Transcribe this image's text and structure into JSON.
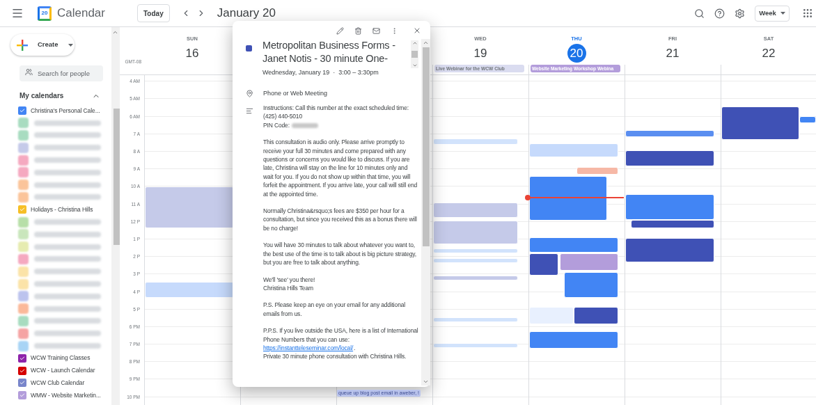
{
  "app": {
    "logo_day": "20",
    "name": "Calendar",
    "today_button": "Today",
    "period_title": "January 20",
    "view_button": "Week"
  },
  "sidebar": {
    "create_button": "Create",
    "search_placeholder": "Search for people",
    "section_title": "My calendars",
    "calendars": [
      {
        "kind": "calendar",
        "label": "Christina's Personal Cale...",
        "color": "#4285f4",
        "checked": true
      },
      {
        "kind": "blurred",
        "color": "#a8dcc0"
      },
      {
        "kind": "blurred",
        "color": "#a8dcc0"
      },
      {
        "kind": "blurred",
        "color": "#c5cae9"
      },
      {
        "kind": "blurred",
        "color": "#f5a9c0"
      },
      {
        "kind": "blurred",
        "color": "#f5a9c0"
      },
      {
        "kind": "blurred",
        "color": "#fbc49a"
      },
      {
        "kind": "blurred",
        "color": "#fbc49a"
      },
      {
        "kind": "calendar",
        "label": "Holidays - Christina Hills",
        "color": "#f6bf26",
        "checked": true
      },
      {
        "kind": "blurred",
        "color": "#b7dfa8"
      },
      {
        "kind": "blurred",
        "color": "#c9e6bc"
      },
      {
        "kind": "blurred",
        "color": "#e6ecb0"
      },
      {
        "kind": "blurred",
        "color": "#f5a9c0"
      },
      {
        "kind": "blurred",
        "color": "#fbe3a8"
      },
      {
        "kind": "blurred",
        "color": "#fbe3a8"
      },
      {
        "kind": "blurred",
        "color": "#bcc3ee"
      },
      {
        "kind": "blurred",
        "color": "#fbb99a"
      },
      {
        "kind": "blurred",
        "color": "#a8dcc0"
      },
      {
        "kind": "blurred",
        "color": "#f5a3a3"
      },
      {
        "kind": "blurred",
        "color": "#a8d4f5"
      },
      {
        "kind": "calendar",
        "label": "WCW Training Classes",
        "color": "#8e24aa",
        "checked": true
      },
      {
        "kind": "calendar",
        "label": "WCW - Launch Calendar",
        "color": "#d50000",
        "checked": true
      },
      {
        "kind": "calendar",
        "label": "WCW Club Calendar",
        "color": "#7986cb",
        "checked": true
      },
      {
        "kind": "calendar",
        "label": "WMW - Website Marketin...",
        "color": "#b39ddb",
        "checked": true
      }
    ]
  },
  "timezone": "GMT-08",
  "hours": [
    "4 AM",
    "5 AM",
    "6 AM",
    "7 A",
    "8 A",
    "9 A",
    "10 A",
    "11 A",
    "12 P",
    "1 P",
    "2 P",
    "3 P",
    "4 P",
    "5 P",
    "6 PM",
    "7 PM",
    "8 PM",
    "9 PM",
    "10 PM"
  ],
  "days": [
    {
      "weekday": "SUN",
      "date": "16",
      "selected": false,
      "events": [
        {
          "color": "#c5cae9"
        },
        {
          "color": "#c6dafc"
        }
      ]
    },
    {
      "weekday": "WED",
      "date": "19",
      "selected": false,
      "all_day": {
        "title": "Live Webinar for the WCW Club",
        "color": "#dadcf0"
      },
      "events": [
        {
          "color": "#d2e3fc"
        },
        {
          "color": "#c5cae9"
        },
        {
          "color": "#c5cae9"
        },
        {
          "color": "#d2e3fc"
        },
        {
          "color": "#d2e3fc"
        },
        {
          "color": "#c5cae9"
        },
        {
          "color": "#d2e3fc"
        },
        {
          "color": "#d2e3fc"
        }
      ]
    },
    {
      "weekday": "THU",
      "date": "20",
      "selected": true,
      "all_day": {
        "title": "Website Marketing Workshop Webina",
        "color": "#b39ddb"
      },
      "events": [
        {
          "color": "#c6dafc"
        },
        {
          "color": "#4285f4"
        },
        {
          "color": "#f6b8a6"
        },
        {
          "color": "#4285f4"
        },
        {
          "color": "#3f51b5"
        },
        {
          "color": "#b39ddb"
        },
        {
          "color": "#4285f4"
        },
        {
          "color": "#e8f0fe"
        },
        {
          "color": "#3f51b5"
        },
        {
          "color": "#4285f4"
        }
      ]
    },
    {
      "weekday": "FRI",
      "date": "21",
      "selected": false,
      "events": [
        {
          "color": "#5a8ef0"
        },
        {
          "color": "#3f51b5"
        },
        {
          "color": "#4285f4"
        },
        {
          "color": "#3f51b5"
        },
        {
          "color": "#3f51b5"
        }
      ]
    },
    {
      "weekday": "SAT",
      "date": "22",
      "selected": false,
      "events": [
        {
          "color": "#3f51b5"
        },
        {
          "color": "#4285f4"
        }
      ]
    }
  ],
  "peeking_event": {
    "title": "queue up blog post email in aweber, !",
    "color": "#b9c3ec"
  },
  "popup": {
    "color": "#3f51b5",
    "title_lines": [
      "Metropolitan Business Forms -",
      "Janet Notis - 30 minute One-"
    ],
    "when": "Wednesday, January 19  ·  3:00 – 3:30pm",
    "location": "Phone or Web Meeting",
    "description": [
      {
        "kind": "lines",
        "lines": [
          "Instructions: Call this number at the exact scheduled time:",
          "(425) 440-5010"
        ]
      },
      {
        "kind": "redacted",
        "label": "PIN Code:"
      },
      {
        "kind": "para",
        "text": "This consultation is audio only. Please arrive promptly to receive your full 30 minutes and come prepared with any questions or concerns you would like to discuss. If you are late, Christina will stay on the line for 10 minutes only and wait for you. If you do not show up within that time, you will forfeit the appointment. If you arrive late, your call will still end at the appointed time."
      },
      {
        "kind": "para",
        "text": "Normally Christina&rsquo;s fees are $350 per hour for a consultation, but since you received this as a bonus there will be no charge!"
      },
      {
        "kind": "para",
        "text": "You will have 30 minutes to talk about whatever you want to, the best use of the time is to talk about is big picture strategy, but you are free to talk about anything."
      },
      {
        "kind": "lines",
        "lines": [
          "We'll 'see' you there!",
          "Christina Hills Team"
        ]
      },
      {
        "kind": "para",
        "text": "P.S. Please keep an eye on your email for any additional emails from us."
      },
      {
        "kind": "link_para",
        "text": "P.P.S. If you live outside the USA, here is a list of International Phone Numbers that you can use:",
        "link": "https://instantteleseminar.com/local/",
        "after": "."
      },
      {
        "kind": "lines",
        "lines": [
          "Private 30 minute phone consultation with Christina Hills."
        ]
      }
    ]
  }
}
